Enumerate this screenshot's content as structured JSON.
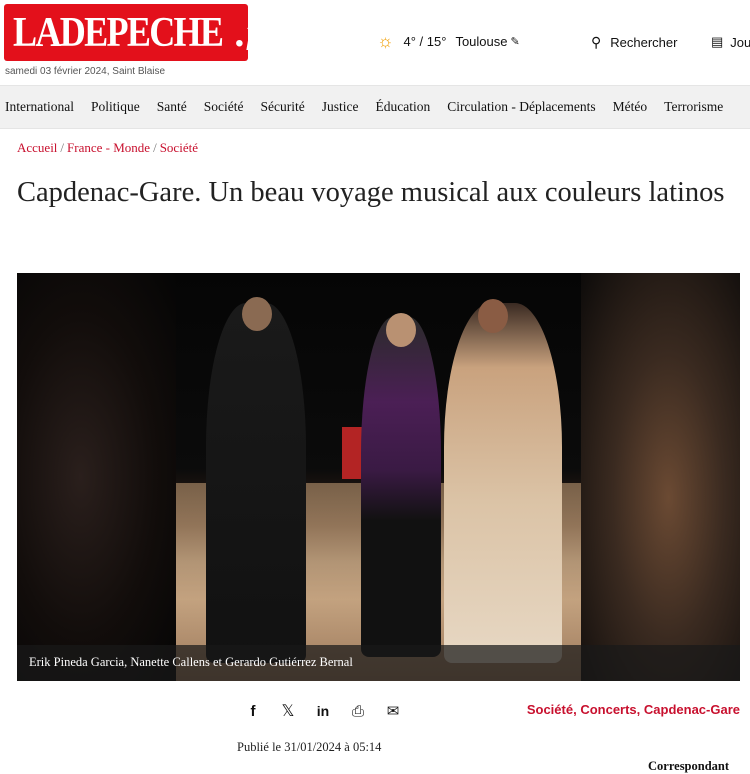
{
  "header": {
    "logo_text": "LADEPECHE",
    "logo_dot": ".",
    "logo_tld": "fr",
    "date_line": "samedi 03 février 2024, Saint Blaise",
    "weather": {
      "icon": "sun-icon",
      "temps": "4° / 15°",
      "city": "Toulouse"
    },
    "search_label": "Rechercher",
    "journal_label": "Journal"
  },
  "nav": {
    "items": [
      "International",
      "Politique",
      "Santé",
      "Société",
      "Sécurité",
      "Justice",
      "Éducation",
      "Circulation - Déplacements",
      "Météo",
      "Terrorisme"
    ]
  },
  "breadcrumb": {
    "items": [
      "Accueil",
      "France - Monde",
      "Société"
    ],
    "separator": "/"
  },
  "article": {
    "title": "Capdenac-Gare. Un beau voyage musical aux couleurs latinos",
    "photo_caption": "Erik Pineda Garcia, Nanette Callens et Gerardo Gutiérrez Bernal",
    "tags": [
      "Société",
      "Concerts",
      "Capdenac-Gare"
    ],
    "published": "Publié le 31/01/2024 à 05:14",
    "author_label": "Correspondant"
  },
  "share_icons": [
    "facebook-icon",
    "x-icon",
    "linkedin-icon",
    "print-icon",
    "email-icon"
  ],
  "colors": {
    "brand_red": "#e3101b",
    "link_red": "#c8102e",
    "nav_bg": "#f1f1f1"
  }
}
